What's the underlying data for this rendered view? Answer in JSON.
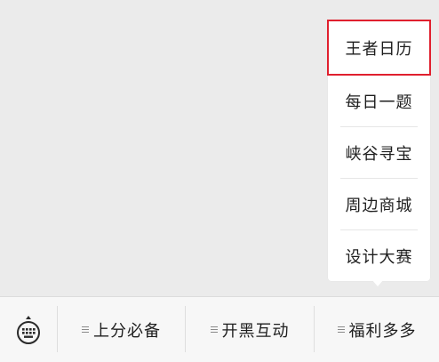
{
  "submenu": {
    "items": [
      {
        "label": "王者日历"
      },
      {
        "label": "每日一题"
      },
      {
        "label": "峡谷寻宝"
      },
      {
        "label": "周边商城"
      },
      {
        "label": "设计大赛"
      }
    ]
  },
  "bottom_bar": {
    "keyboard_icon": "keyboard-icon",
    "menus": [
      {
        "label": "上分必备"
      },
      {
        "label": "开黑互动"
      },
      {
        "label": "福利多多"
      }
    ]
  },
  "colors": {
    "highlight_border": "#e0202e",
    "background": "#ebebeb"
  }
}
